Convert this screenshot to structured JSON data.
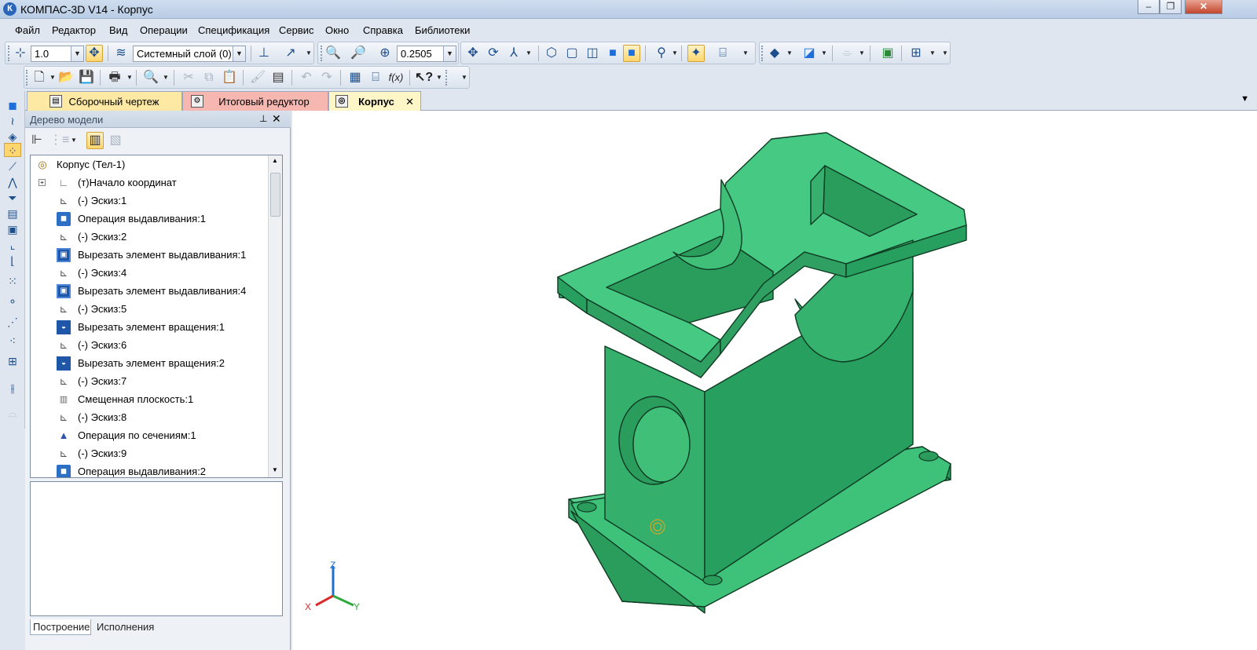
{
  "window": {
    "title": "КОМПАС-3D V14 - Корпус",
    "app_icon": "К",
    "buttons": [
      "minimize-icon",
      "restore-icon",
      "close-icon"
    ]
  },
  "menu": [
    "Файл",
    "Редактор",
    "Вид",
    "Операции",
    "Спецификация",
    "Сервис",
    "Окно",
    "Справка",
    "Библиотеки"
  ],
  "toolbar": {
    "step": "1.0",
    "layer": "Системный слой (0)",
    "zoom": "0.2505"
  },
  "doc_tabs": [
    {
      "label": "Сборочный чертеж",
      "color": "#fde9a3"
    },
    {
      "label": "Итоговый редуктор",
      "color": "#f6b7b1"
    },
    {
      "label": "Корпус",
      "color": "#fff6c8",
      "active": true
    }
  ],
  "panel": {
    "title": "Дерево модели",
    "pin": "ᵽ",
    "close": "✕"
  },
  "tree": {
    "root": "Корпус (Тел-1)",
    "items": [
      {
        "label": "(т)Начало координат",
        "icon": "origin"
      },
      {
        "label": "(-) Эскиз:1",
        "icon": "sketch"
      },
      {
        "label": "Операция выдавливания:1",
        "icon": "extrude"
      },
      {
        "label": "(-) Эскиз:2",
        "icon": "sketch"
      },
      {
        "label": "Вырезать элемент выдавливания:1",
        "icon": "cut"
      },
      {
        "label": "(-) Эскиз:4",
        "icon": "sketch"
      },
      {
        "label": "Вырезать элемент выдавливания:4",
        "icon": "cut"
      },
      {
        "label": "(-) Эскиз:5",
        "icon": "sketch"
      },
      {
        "label": "Вырезать элемент вращения:1",
        "icon": "revolve"
      },
      {
        "label": "(-) Эскиз:6",
        "icon": "sketch"
      },
      {
        "label": "Вырезать элемент вращения:2",
        "icon": "revolve"
      },
      {
        "label": "(-) Эскиз:7",
        "icon": "sketch"
      },
      {
        "label": "Смещенная плоскость:1",
        "icon": "plane"
      },
      {
        "label": "(-) Эскиз:8",
        "icon": "sketch"
      },
      {
        "label": "Операция по сечениям:1",
        "icon": "loft"
      },
      {
        "label": "(-) Эскиз:9",
        "icon": "sketch"
      },
      {
        "label": "Операция выдавливания:2",
        "icon": "extrude"
      }
    ]
  },
  "bottom_tabs": [
    "Построение",
    "Исполнения"
  ],
  "axes": {
    "x": "X",
    "y": "Y",
    "z": "Z"
  },
  "colors": {
    "model": "#3ec27a",
    "model_dark": "#27a05f",
    "model_edge": "#0f3a22",
    "accent": "#2d6fc4"
  }
}
